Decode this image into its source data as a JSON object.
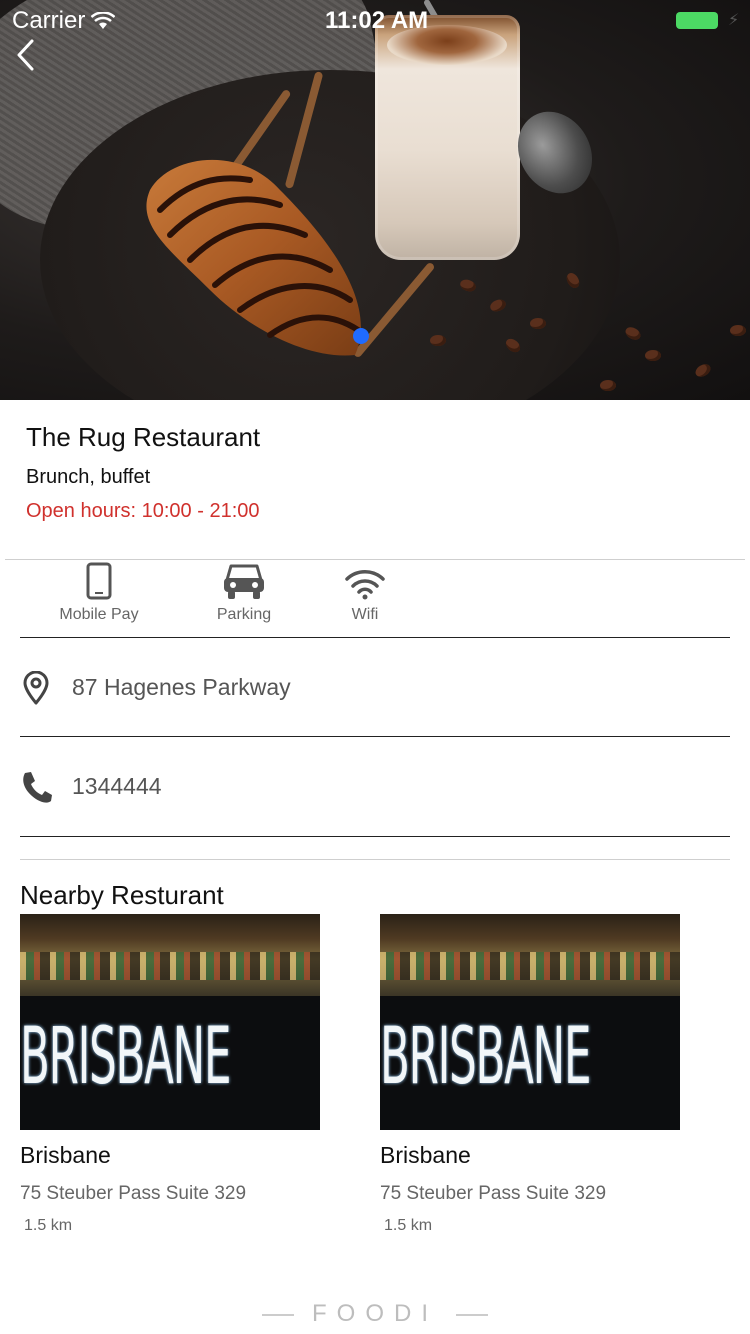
{
  "status_bar": {
    "carrier": "Carrier",
    "time": "11:02 AM"
  },
  "hero": {
    "carousel_pages": 1,
    "active_page": 1
  },
  "restaurant": {
    "name": "The Rug Restaurant",
    "category": "Brunch, buffet",
    "open_hours": "Open hours: 10:00 - 21:00"
  },
  "amenities": [
    {
      "label": "Mobile Pay",
      "icon": "mobile-phone-icon"
    },
    {
      "label": "Parking",
      "icon": "car-icon"
    },
    {
      "label": "Wifi",
      "icon": "wifi-icon"
    }
  ],
  "contact": {
    "address": "87 Hagenes Parkway",
    "address_icon": "map-pin-icon",
    "phone": "1344444",
    "phone_icon": "phone-icon"
  },
  "nearby": {
    "title": "Nearby Resturant",
    "items": [
      {
        "name": "Brisbane",
        "address": "75 Steuber Pass Suite 329",
        "distance": "1.5 km",
        "image_text": "BRISBANE"
      },
      {
        "name": "Brisbane",
        "address": "75 Steuber Pass Suite 329",
        "distance": "1.5 km",
        "image_text": "BRISBANE"
      }
    ]
  },
  "footer": {
    "brand": "FOODI"
  },
  "colors": {
    "hours": "#d0312d",
    "page_dot": "#1f6bff",
    "battery": "#4cd964"
  }
}
